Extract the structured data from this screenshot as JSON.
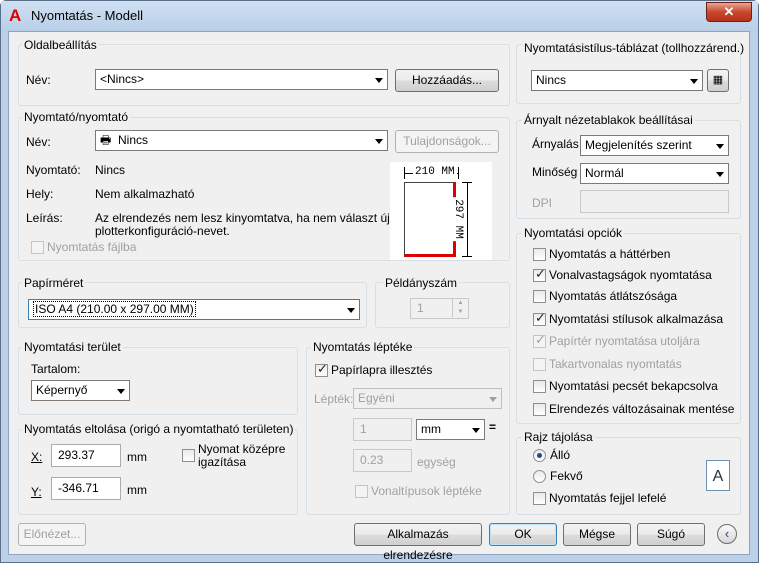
{
  "window": {
    "title": "Nyomtatás - Modell",
    "close": "✕"
  },
  "page_setup": {
    "group_label": "Oldalbeállítás",
    "name_label": "Név:",
    "name_value": "<Nincs>",
    "add_button": "Hozzáadás..."
  },
  "printer": {
    "group_label": "Nyomtató/nyomtató",
    "name_label": "Név:",
    "name_value": "Nincs",
    "properties_button": "Tulajdonságok...",
    "plotter_label": "Nyomtató:",
    "plotter_value": "Nincs",
    "where_label": "Hely:",
    "where_value": "Nem alkalmazható",
    "desc_label": "Leírás:",
    "desc_line1": "Az elrendezés nem lesz kinyomtatva, ha nem választ új",
    "desc_line2": "plotterkonfiguráció-nevet.",
    "print_to_file": "Nyomtatás fájlba",
    "preview_width": "210 MM",
    "preview_height": "297 MM"
  },
  "paper_size": {
    "group_label": "Papírméret",
    "value": "ISO A4 (210.00 x 297.00 MM)"
  },
  "copies": {
    "group_label": "Példányszám",
    "value": "1"
  },
  "plot_area": {
    "group_label": "Nyomtatási terület",
    "what_label": "Tartalom:",
    "what_value": "Képernyő"
  },
  "plot_scale": {
    "group_label": "Nyomtatás léptéke",
    "fit_paper": "Papírlapra illesztés",
    "scale_label": "Lépték:",
    "scale_value": "Egyéni",
    "value1": "1",
    "unit": "mm",
    "equals": "=",
    "value2": "0.23",
    "unit2": "egység",
    "lineweights": "Vonaltípusok léptéke"
  },
  "plot_offset": {
    "group_label": "Nyomtatás eltolása (origó a nyomtatható területen)",
    "x_label": "X:",
    "x_value": "293.37",
    "x_unit": "mm",
    "y_label": "Y:",
    "y_value": "-346.71",
    "y_unit": "mm",
    "center_line1": "Nyomat középre",
    "center_line2": "igazítása"
  },
  "plot_style": {
    "group_label": "Nyomtatásistílus-táblázat (tollhozzárend.)",
    "value": "Nincs"
  },
  "shaded": {
    "group_label": "Árnyalt nézetablakok beállításai",
    "shade_label": "Árnyalás",
    "shade_value": "Megjelenítés szerint",
    "quality_label": "Minőség",
    "quality_value": "Normál",
    "dpi_label": "DPI"
  },
  "options": {
    "group_label": "Nyomtatási opciók",
    "items": [
      {
        "label": "Nyomtatás a háttérben"
      },
      {
        "label": "Vonalvastagságok nyomtatása"
      },
      {
        "label": "Nyomtatás átlátszósága"
      },
      {
        "label": "Nyomtatási stílusok alkalmazása"
      },
      {
        "label": "Papírtér nyomtatása utoljára"
      },
      {
        "label": "Takartvonalas nyomtatás"
      },
      {
        "label": "Nyomtatási pecsét bekapcsolva"
      },
      {
        "label": "Elrendezés változásainak mentése"
      }
    ]
  },
  "orientation": {
    "group_label": "Rajz tájolása",
    "portrait": "Álló",
    "landscape": "Fekvő",
    "upside_down": "Nyomtatás fejjel lefelé",
    "icon_letter": "A"
  },
  "footer": {
    "preview": "Előnézet...",
    "apply": "Alkalmazás elrendezésre",
    "ok": "OK",
    "cancel": "Mégse",
    "help": "Súgó"
  }
}
